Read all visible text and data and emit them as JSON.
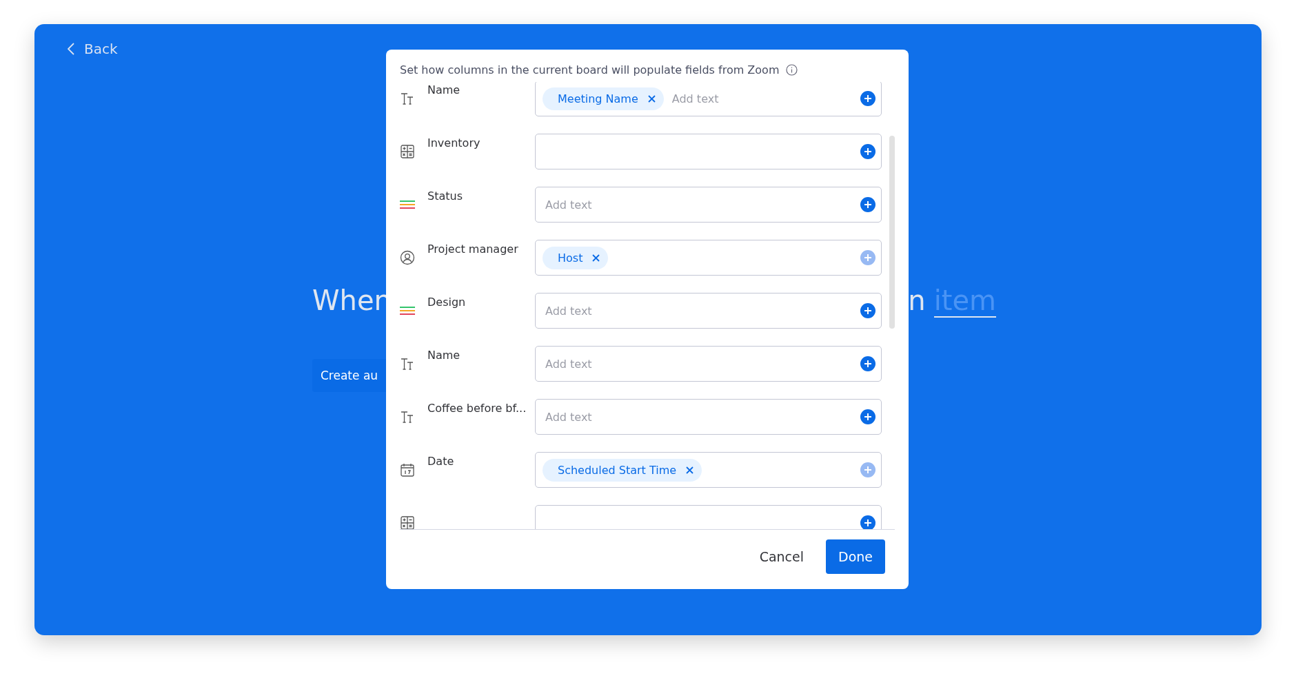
{
  "back": {
    "label": "Back"
  },
  "headline": {
    "start": "When",
    "end": "n",
    "link": "item"
  },
  "create_button": {
    "label": "Create au"
  },
  "dialog": {
    "description": "Set how columns in the current board will populate fields from Zoom",
    "rows": [
      {
        "kind": "text",
        "label": "Name",
        "chips": [
          "Meeting Name"
        ],
        "placeholder": "Add text",
        "add_disabled": false
      },
      {
        "kind": "table",
        "label": "Inventory",
        "add_disabled": false
      },
      {
        "kind": "status",
        "label": "Status",
        "placeholder": "Add text",
        "add_disabled": false
      },
      {
        "kind": "person",
        "label": "Project manager",
        "chips": [
          "Host"
        ],
        "add_disabled": true
      },
      {
        "kind": "status",
        "label": "Design",
        "placeholder": "Add text",
        "add_disabled": false
      },
      {
        "kind": "text",
        "label": "Name",
        "placeholder": "Add text",
        "add_disabled": false
      },
      {
        "kind": "text",
        "label": "Coffee before bf...",
        "placeholder": "Add text",
        "add_disabled": false
      },
      {
        "kind": "calendar",
        "label": "Date",
        "chips": [
          "Scheduled Start Time"
        ],
        "add_disabled": true
      },
      {
        "kind": "table",
        "add_disabled": false
      }
    ],
    "cancel": "Cancel",
    "done": "Done"
  }
}
